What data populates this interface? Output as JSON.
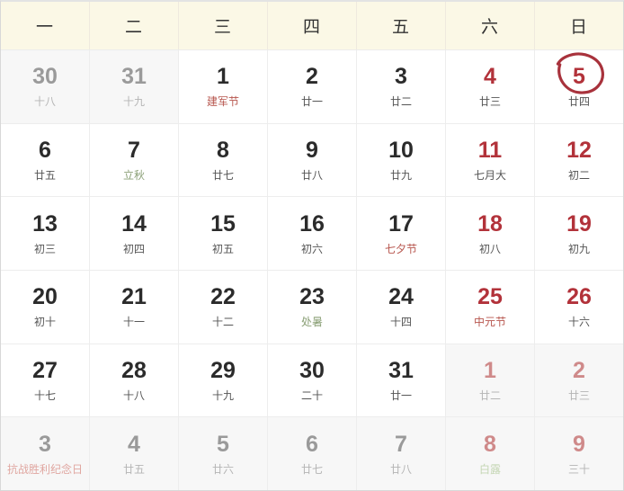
{
  "header": {
    "weekdays": [
      "一",
      "二",
      "三",
      "四",
      "五",
      "六",
      "日"
    ]
  },
  "colors": {
    "header_bg": "#fbf8e6",
    "weekend": "#b2323a",
    "festival": "#b7564e",
    "solar_term": "#8ba077",
    "muted": "#9a9a9a",
    "marker": "#a8323c"
  },
  "marker": {
    "icon": "hand-drawn-circle-icon",
    "on_day": "5"
  },
  "weeks": [
    {
      "days": [
        {
          "num": "30",
          "sub": "十八",
          "num_class": "muted",
          "sub_class": "muted",
          "cell_class": "other",
          "marked": false
        },
        {
          "num": "31",
          "sub": "十九",
          "num_class": "muted",
          "sub_class": "muted",
          "cell_class": "other",
          "marked": false
        },
        {
          "num": "1",
          "sub": "建军节",
          "num_class": "",
          "sub_class": "festival",
          "cell_class": "",
          "marked": false
        },
        {
          "num": "2",
          "sub": "廿一",
          "num_class": "",
          "sub_class": "",
          "cell_class": "",
          "marked": false
        },
        {
          "num": "3",
          "sub": "廿二",
          "num_class": "",
          "sub_class": "",
          "cell_class": "",
          "marked": false
        },
        {
          "num": "4",
          "sub": "廿三",
          "num_class": "weekend",
          "sub_class": "",
          "cell_class": "",
          "marked": false
        },
        {
          "num": "5",
          "sub": "廿四",
          "num_class": "weekend",
          "sub_class": "",
          "cell_class": "",
          "marked": true
        }
      ]
    },
    {
      "days": [
        {
          "num": "6",
          "sub": "廿五",
          "num_class": "",
          "sub_class": "",
          "cell_class": "",
          "marked": false
        },
        {
          "num": "7",
          "sub": "立秋",
          "num_class": "",
          "sub_class": "term",
          "cell_class": "",
          "marked": false
        },
        {
          "num": "8",
          "sub": "廿七",
          "num_class": "",
          "sub_class": "",
          "cell_class": "",
          "marked": false
        },
        {
          "num": "9",
          "sub": "廿八",
          "num_class": "",
          "sub_class": "",
          "cell_class": "",
          "marked": false
        },
        {
          "num": "10",
          "sub": "廿九",
          "num_class": "",
          "sub_class": "",
          "cell_class": "",
          "marked": false
        },
        {
          "num": "11",
          "sub": "七月大",
          "num_class": "weekend",
          "sub_class": "",
          "cell_class": "",
          "marked": false
        },
        {
          "num": "12",
          "sub": "初二",
          "num_class": "weekend",
          "sub_class": "",
          "cell_class": "",
          "marked": false
        }
      ]
    },
    {
      "days": [
        {
          "num": "13",
          "sub": "初三",
          "num_class": "",
          "sub_class": "",
          "cell_class": "",
          "marked": false
        },
        {
          "num": "14",
          "sub": "初四",
          "num_class": "",
          "sub_class": "",
          "cell_class": "",
          "marked": false
        },
        {
          "num": "15",
          "sub": "初五",
          "num_class": "",
          "sub_class": "",
          "cell_class": "",
          "marked": false
        },
        {
          "num": "16",
          "sub": "初六",
          "num_class": "",
          "sub_class": "",
          "cell_class": "",
          "marked": false
        },
        {
          "num": "17",
          "sub": "七夕节",
          "num_class": "",
          "sub_class": "festival",
          "cell_class": "",
          "marked": false
        },
        {
          "num": "18",
          "sub": "初八",
          "num_class": "weekend",
          "sub_class": "",
          "cell_class": "",
          "marked": false
        },
        {
          "num": "19",
          "sub": "初九",
          "num_class": "weekend",
          "sub_class": "",
          "cell_class": "",
          "marked": false
        }
      ]
    },
    {
      "days": [
        {
          "num": "20",
          "sub": "初十",
          "num_class": "",
          "sub_class": "",
          "cell_class": "",
          "marked": false
        },
        {
          "num": "21",
          "sub": "十一",
          "num_class": "",
          "sub_class": "",
          "cell_class": "",
          "marked": false
        },
        {
          "num": "22",
          "sub": "十二",
          "num_class": "",
          "sub_class": "",
          "cell_class": "",
          "marked": false
        },
        {
          "num": "23",
          "sub": "处暑",
          "num_class": "",
          "sub_class": "term",
          "cell_class": "",
          "marked": false
        },
        {
          "num": "24",
          "sub": "十四",
          "num_class": "",
          "sub_class": "",
          "cell_class": "",
          "marked": false
        },
        {
          "num": "25",
          "sub": "中元节",
          "num_class": "weekend",
          "sub_class": "festival",
          "cell_class": "",
          "marked": false
        },
        {
          "num": "26",
          "sub": "十六",
          "num_class": "weekend",
          "sub_class": "",
          "cell_class": "",
          "marked": false
        }
      ]
    },
    {
      "days": [
        {
          "num": "27",
          "sub": "十七",
          "num_class": "",
          "sub_class": "",
          "cell_class": "",
          "marked": false
        },
        {
          "num": "28",
          "sub": "十八",
          "num_class": "",
          "sub_class": "",
          "cell_class": "",
          "marked": false
        },
        {
          "num": "29",
          "sub": "十九",
          "num_class": "",
          "sub_class": "",
          "cell_class": "",
          "marked": false
        },
        {
          "num": "30",
          "sub": "二十",
          "num_class": "",
          "sub_class": "",
          "cell_class": "",
          "marked": false
        },
        {
          "num": "31",
          "sub": "廿一",
          "num_class": "",
          "sub_class": "",
          "cell_class": "",
          "marked": false
        },
        {
          "num": "1",
          "sub": "廿二",
          "num_class": "muted-weekend",
          "sub_class": "muted",
          "cell_class": "other",
          "marked": false
        },
        {
          "num": "2",
          "sub": "廿三",
          "num_class": "muted-weekend",
          "sub_class": "muted",
          "cell_class": "other",
          "marked": false
        }
      ]
    },
    {
      "days": [
        {
          "num": "3",
          "sub": "抗战胜利纪念日",
          "num_class": "muted",
          "sub_class": "muted-festival",
          "cell_class": "other",
          "marked": false
        },
        {
          "num": "4",
          "sub": "廿五",
          "num_class": "muted",
          "sub_class": "muted",
          "cell_class": "other",
          "marked": false
        },
        {
          "num": "5",
          "sub": "廿六",
          "num_class": "muted",
          "sub_class": "muted",
          "cell_class": "other",
          "marked": false
        },
        {
          "num": "6",
          "sub": "廿七",
          "num_class": "muted",
          "sub_class": "muted",
          "cell_class": "other",
          "marked": false
        },
        {
          "num": "7",
          "sub": "廿八",
          "num_class": "muted",
          "sub_class": "muted",
          "cell_class": "other",
          "marked": false
        },
        {
          "num": "8",
          "sub": "白露",
          "num_class": "muted-weekend",
          "sub_class": "muted-term",
          "cell_class": "other",
          "marked": false
        },
        {
          "num": "9",
          "sub": "三十",
          "num_class": "muted-weekend",
          "sub_class": "muted",
          "cell_class": "other",
          "marked": false
        }
      ]
    }
  ]
}
